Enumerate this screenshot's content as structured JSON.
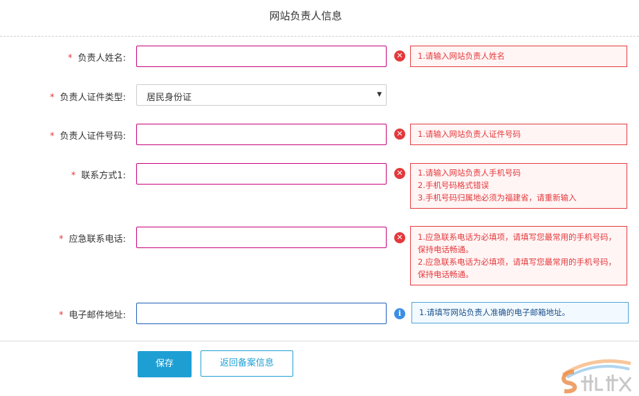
{
  "page": {
    "title": "网站负责人信息"
  },
  "fields": [
    {
      "label": "负责人姓名:",
      "required": "*",
      "type": "input",
      "value": "",
      "status": "error",
      "messages": [
        "1.请输入网站负责人姓名"
      ]
    },
    {
      "label": "负责人证件类型:",
      "required": "*",
      "type": "select",
      "value": "居民身份证"
    },
    {
      "label": "负责人证件号码:",
      "required": "*",
      "type": "input",
      "value": "",
      "status": "error",
      "messages": [
        "1.请输入网站负责人证件号码"
      ]
    },
    {
      "label": "联系方式1:",
      "required": "*",
      "type": "input",
      "value": "",
      "status": "error",
      "messages": [
        "1.请输入网站负责人手机号码",
        "2.手机号码格式错误",
        "3.手机号码归属地必须为福建省，请重新输入"
      ]
    },
    {
      "label": "应急联系电话:",
      "required": "*",
      "type": "input",
      "value": "",
      "status": "error",
      "messages": [
        "1.应急联系电话为必填项，请填写您最常用的手机号码，保持电话畅通。",
        "2.应急联系电话为必填项，请填写您最常用的手机号码，保持电话畅通。"
      ]
    },
    {
      "label": "电子邮件地址:",
      "required": "*",
      "type": "input",
      "value": "",
      "status": "info",
      "messages": [
        "1.请填写网站负责人准确的电子邮箱地址。"
      ]
    }
  ],
  "buttons": {
    "save": "保存",
    "back": "返回备案信息"
  },
  "icons": {
    "error": "error-circle-icon",
    "info": "info-circle-icon",
    "dropdown": "caret-down-icon"
  },
  "colors": {
    "error": "#e4393c",
    "accent": "#1e9fd4",
    "invalid_border": "#c6007a"
  }
}
